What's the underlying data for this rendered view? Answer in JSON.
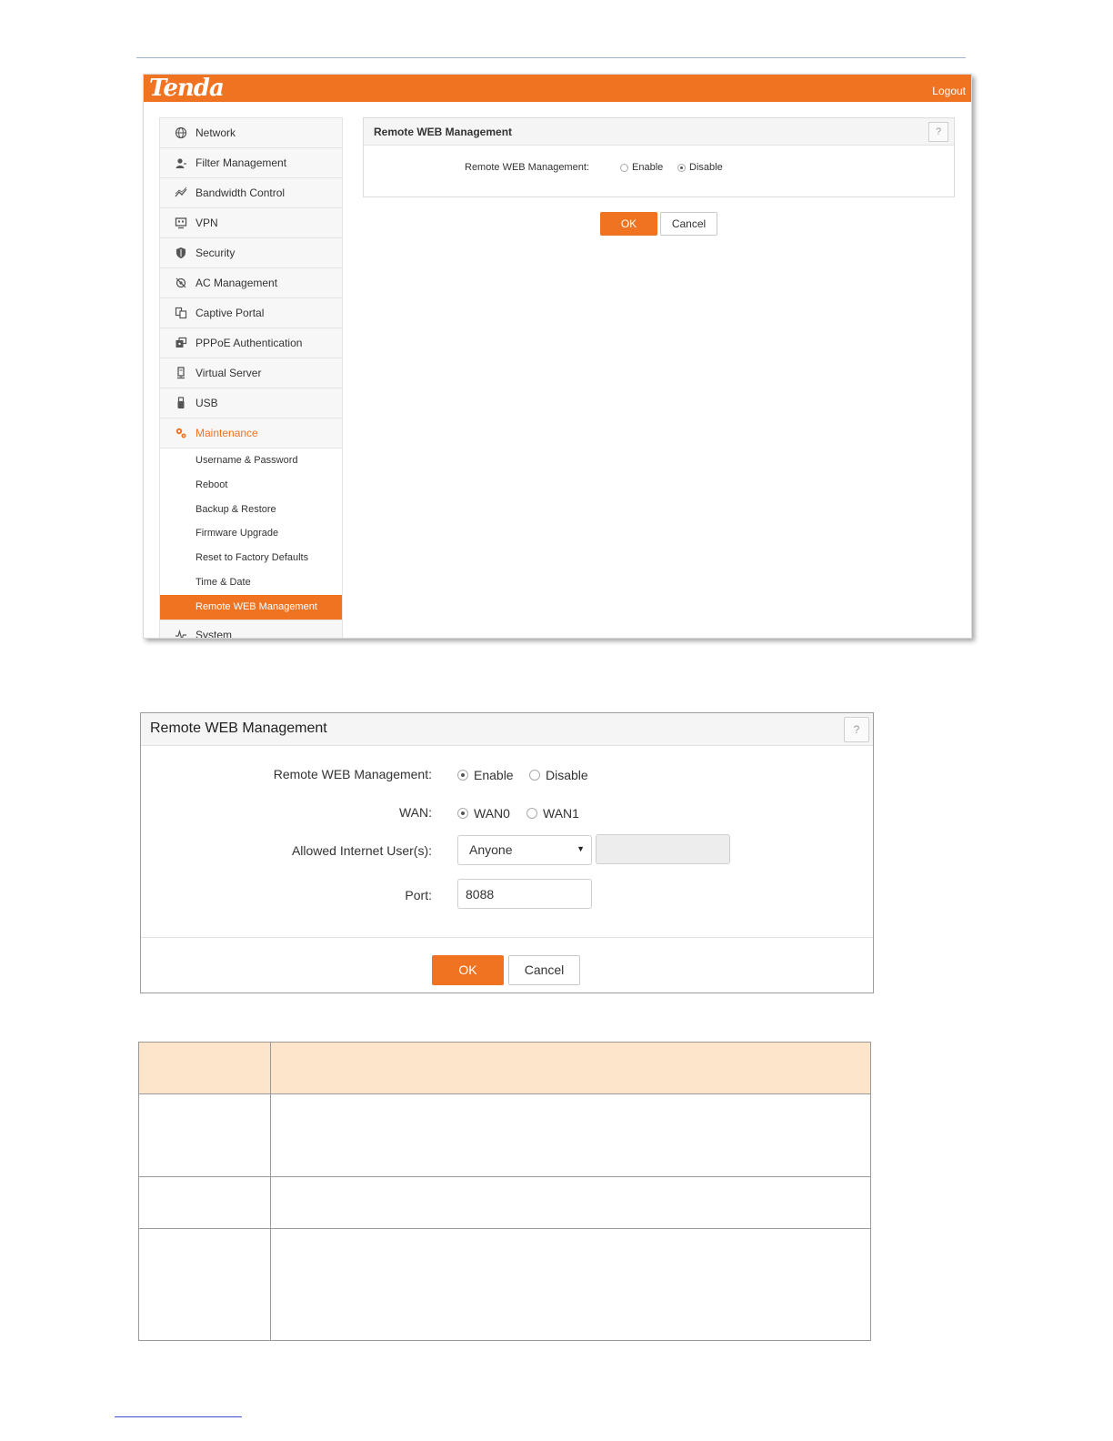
{
  "app": {
    "brand": "Tenda",
    "logout_label": "Logout"
  },
  "colors": {
    "accent": "#f07322",
    "table_header": "#fde5cb"
  },
  "sidebar": {
    "items": [
      {
        "label": "Network",
        "icon": "globe-icon"
      },
      {
        "label": "Filter Management",
        "icon": "user-filter-icon"
      },
      {
        "label": "Bandwidth Control",
        "icon": "chart-line-icon"
      },
      {
        "label": "VPN",
        "icon": "vpn-icon"
      },
      {
        "label": "Security",
        "icon": "shield-icon"
      },
      {
        "label": "AC Management",
        "icon": "ac-management-icon"
      },
      {
        "label": "Captive Portal",
        "icon": "portal-icon"
      },
      {
        "label": "PPPoE Authentication",
        "icon": "pppoe-icon"
      },
      {
        "label": "Virtual Server",
        "icon": "server-icon"
      },
      {
        "label": "USB",
        "icon": "usb-icon"
      },
      {
        "label": "Maintenance",
        "icon": "gears-icon",
        "active": true
      }
    ],
    "maintenance_sub": [
      "Username & Password",
      "Reboot",
      "Backup & Restore",
      "Firmware Upgrade",
      "Reset to Factory Defaults",
      "Time & Date",
      "Remote WEB Management"
    ],
    "selected_sub": "Remote WEB Management",
    "last_item": {
      "label": "System",
      "icon": "pulse-icon"
    }
  },
  "panel1": {
    "title": "Remote WEB Management",
    "help": "?",
    "field_label": "Remote WEB Management:",
    "option_enable": "Enable",
    "option_disable": "Disable",
    "selected": "Disable",
    "ok_label": "OK",
    "cancel_label": "Cancel"
  },
  "panel2": {
    "title": "Remote WEB Management",
    "help": "?",
    "rwm_label": "Remote WEB Management:",
    "option_enable": "Enable",
    "option_disable": "Disable",
    "rwm_selected": "Enable",
    "wan_label": "WAN:",
    "wan_option_0": "WAN0",
    "wan_option_1": "WAN1",
    "wan_selected": "WAN0",
    "users_label": "Allowed Internet User(s):",
    "users_value": "Anyone",
    "port_label": "Port:",
    "port_value": "8088",
    "ok_label": "OK",
    "cancel_label": "Cancel"
  }
}
